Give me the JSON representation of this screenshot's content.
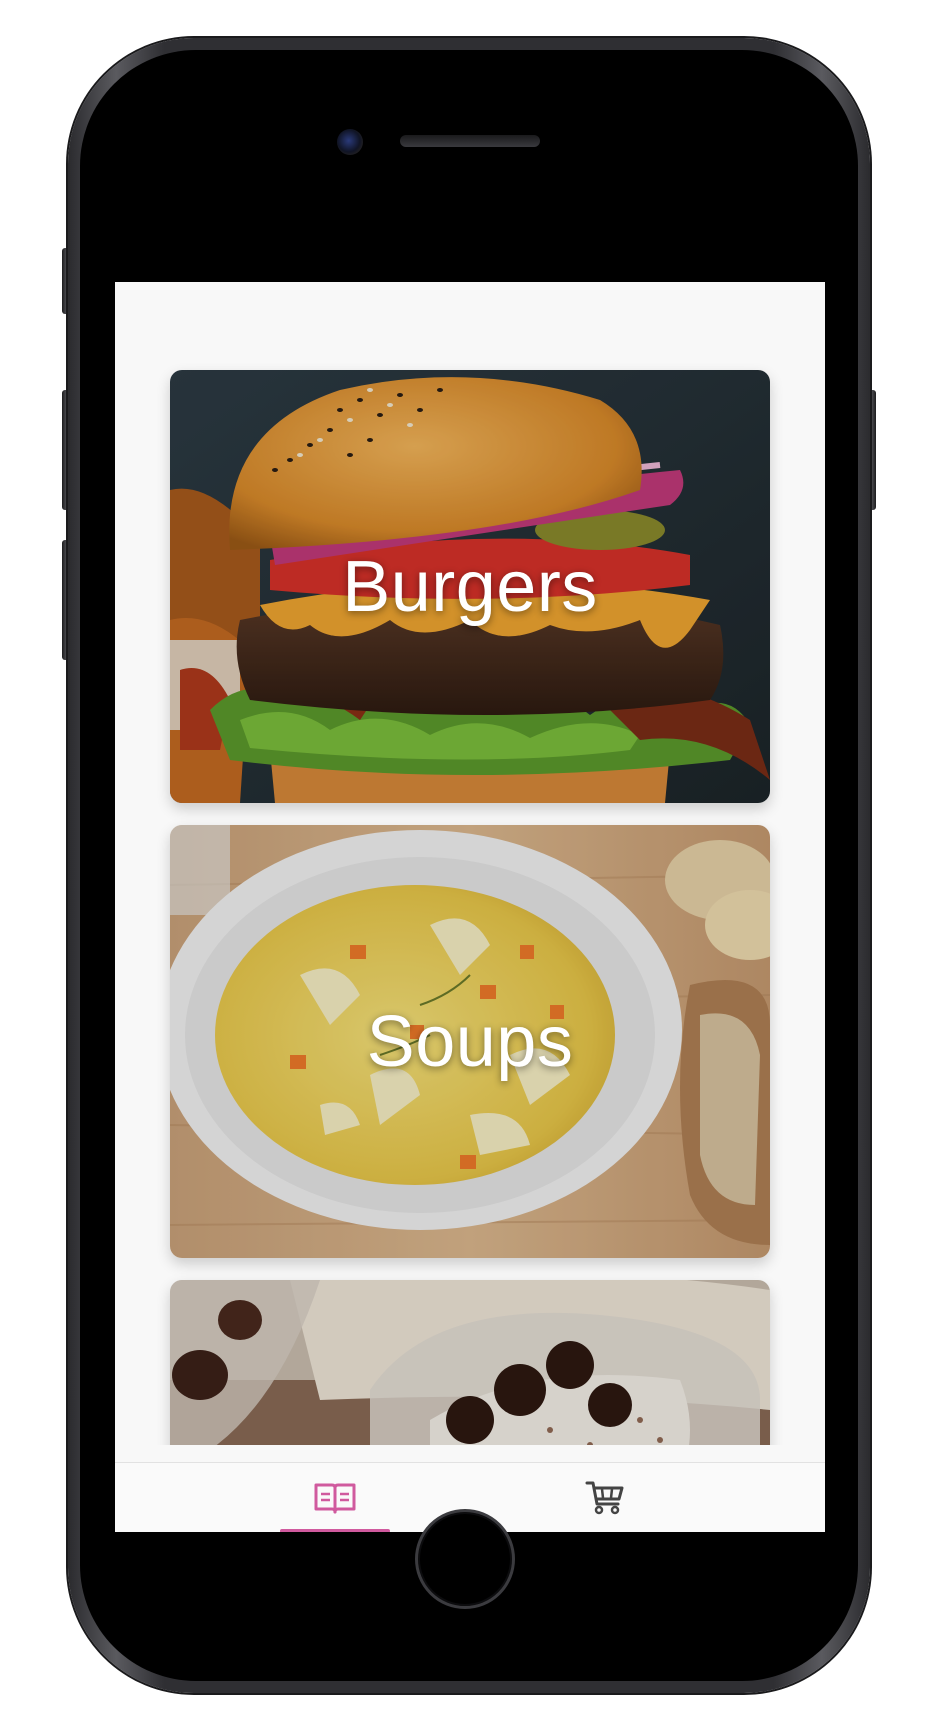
{
  "colors": {
    "accent": "#d05a9e",
    "inactive_icon": "#444444",
    "screen_background": "#f8f8f8"
  },
  "categories": [
    {
      "label": "Burgers"
    },
    {
      "label": "Soups"
    },
    {
      "label": ""
    }
  ],
  "tabbar": {
    "tabs": [
      {
        "icon": "book-icon",
        "active": true
      },
      {
        "icon": "cart-icon",
        "active": false
      }
    ]
  }
}
